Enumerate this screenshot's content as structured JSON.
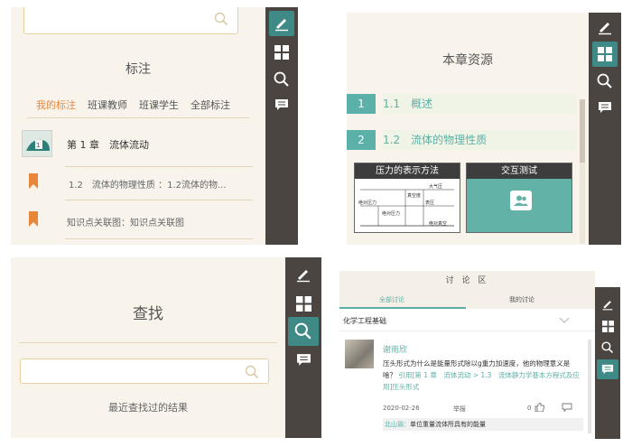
{
  "panel_annotations": {
    "title": "标注",
    "tabs": [
      "我的标注",
      "班课教师",
      "班课学生",
      "全部标注"
    ],
    "chapter": "第 1 章　流体流动",
    "notes": [
      "1.2　流体的物理性质 ：1.2流体的物...",
      "知识点关联图：知识点关联图"
    ]
  },
  "panel_resources": {
    "title": "本章资源",
    "rows": [
      {
        "num": "1",
        "label": "1.1　概述"
      },
      {
        "num": "2",
        "label": "1.2　流体的物理性质"
      }
    ],
    "card1": {
      "header": "压力的表示方法",
      "labels": [
        "大气压",
        "真空度",
        "绝对压力",
        "表压",
        "绝对压力",
        "绝对真空"
      ]
    },
    "card2": {
      "header": "交互测试"
    }
  },
  "panel_search": {
    "title": "查找",
    "recent": "最近查找过的结果"
  },
  "panel_discussion": {
    "title": "讨 论 区",
    "tabs": [
      "全部讨论",
      "我的讨论"
    ],
    "course": "化学工程基础",
    "user": "谢雨欣",
    "post_text": "压头形式为什么是能量形式除以g重力加速度，他的物理意义是啥？",
    "post_ref": "引用[第 1 章　流体流动 > 1.3　流体静力学基本方程式及应用]压头形式",
    "date": "2020-02-26",
    "report": "举报",
    "likes": "0",
    "reply_user": "北山瑜：",
    "reply_text": "单位重量流体所具有的能量"
  },
  "colors": {
    "accent": "#5bb0a7",
    "orange": "#e8863a",
    "rail": "#4a4541",
    "panel_bg": "#f8f4ec"
  },
  "icons": [
    "pen-icon",
    "grid-icon",
    "search-icon",
    "message-icon",
    "bookmark-icon",
    "chevron-down-icon",
    "like-icon",
    "comment-icon",
    "people-icon"
  ]
}
